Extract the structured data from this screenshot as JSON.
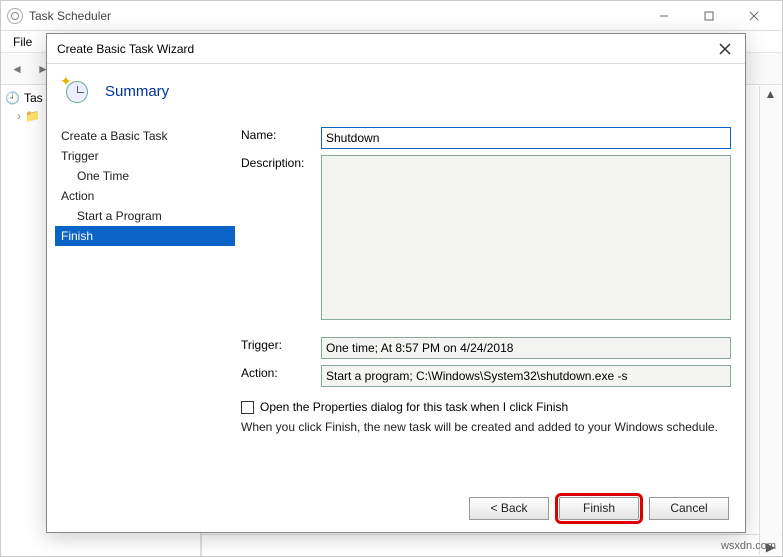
{
  "window": {
    "title": "Task Scheduler",
    "menu": {
      "file": "File"
    }
  },
  "tree": {
    "root": "Task Scheduler (Local)"
  },
  "dialog": {
    "title": "Create Basic Task Wizard",
    "heading": "Summary",
    "steps": {
      "create": "Create a Basic Task",
      "trigger": "Trigger",
      "one_time": "One Time",
      "action": "Action",
      "start_program": "Start a Program",
      "finish": "Finish"
    },
    "labels": {
      "name": "Name:",
      "description": "Description:",
      "trigger": "Trigger:",
      "action": "Action:"
    },
    "fields": {
      "name": "Shutdown",
      "description": "",
      "trigger": "One time; At 8:57 PM on 4/24/2018",
      "action": "Start a program; C:\\Windows\\System32\\shutdown.exe -s"
    },
    "checkbox_label": "Open the Properties dialog for this task when I click Finish",
    "hint": "When you click Finish, the new task will be created and added to your Windows schedule.",
    "buttons": {
      "back": "<  Back",
      "finish": "Finish",
      "cancel": "Cancel"
    }
  },
  "watermark": "wsxdn.com"
}
